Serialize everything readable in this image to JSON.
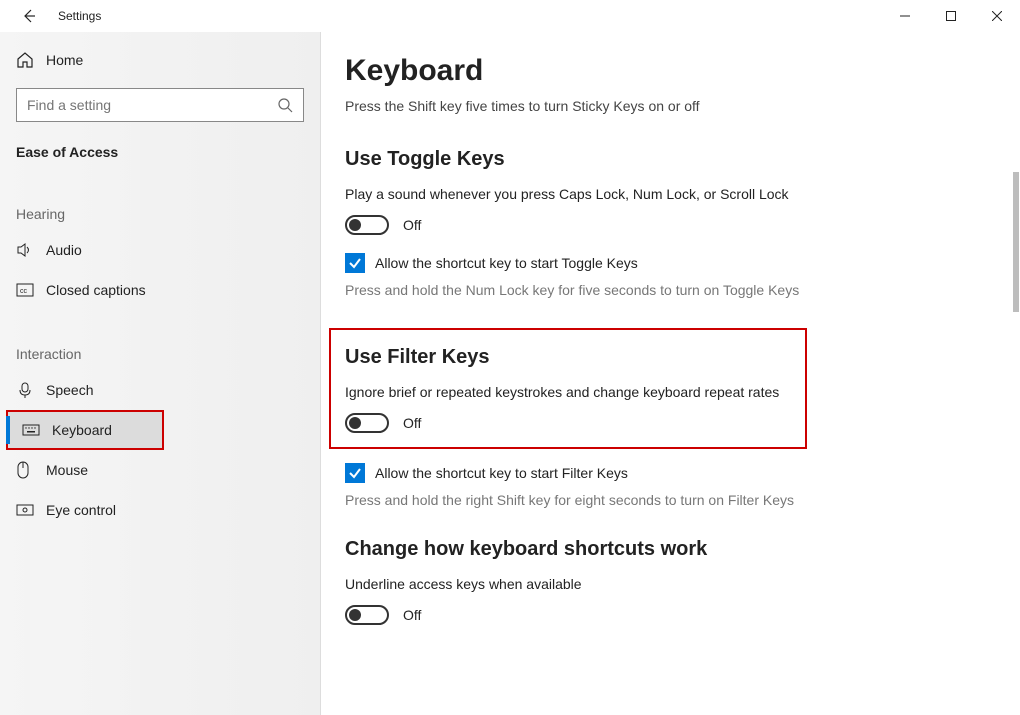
{
  "window": {
    "title": "Settings"
  },
  "sidebar": {
    "home_label": "Home",
    "search_placeholder": "Find a setting",
    "category": "Ease of Access",
    "groups": [
      {
        "header": "Hearing",
        "items": [
          {
            "key": "audio",
            "label": "Audio"
          },
          {
            "key": "closed-captions",
            "label": "Closed captions"
          }
        ]
      },
      {
        "header": "Interaction",
        "items": [
          {
            "key": "speech",
            "label": "Speech"
          },
          {
            "key": "keyboard",
            "label": "Keyboard",
            "selected": true,
            "highlighted": true
          },
          {
            "key": "mouse",
            "label": "Mouse"
          },
          {
            "key": "eye-control",
            "label": "Eye control"
          }
        ]
      }
    ]
  },
  "main": {
    "title": "Keyboard",
    "subtitle": "Press the Shift key five times to turn Sticky Keys on or off",
    "toggle_keys": {
      "heading": "Use Toggle Keys",
      "desc": "Play a sound whenever you press Caps Lock, Num Lock, or Scroll Lock",
      "state": "Off",
      "shortcut_label": "Allow the shortcut key to start Toggle Keys",
      "hint": "Press and hold the Num Lock key for five seconds to turn on Toggle Keys"
    },
    "filter_keys": {
      "heading": "Use Filter Keys",
      "desc": "Ignore brief or repeated keystrokes and change keyboard repeat rates",
      "state": "Off",
      "shortcut_label": "Allow the shortcut key to start Filter Keys",
      "hint": "Press and hold the right Shift key for eight seconds to turn on Filter Keys"
    },
    "shortcuts": {
      "heading": "Change how keyboard shortcuts work",
      "desc": "Underline access keys when available",
      "state": "Off"
    }
  }
}
